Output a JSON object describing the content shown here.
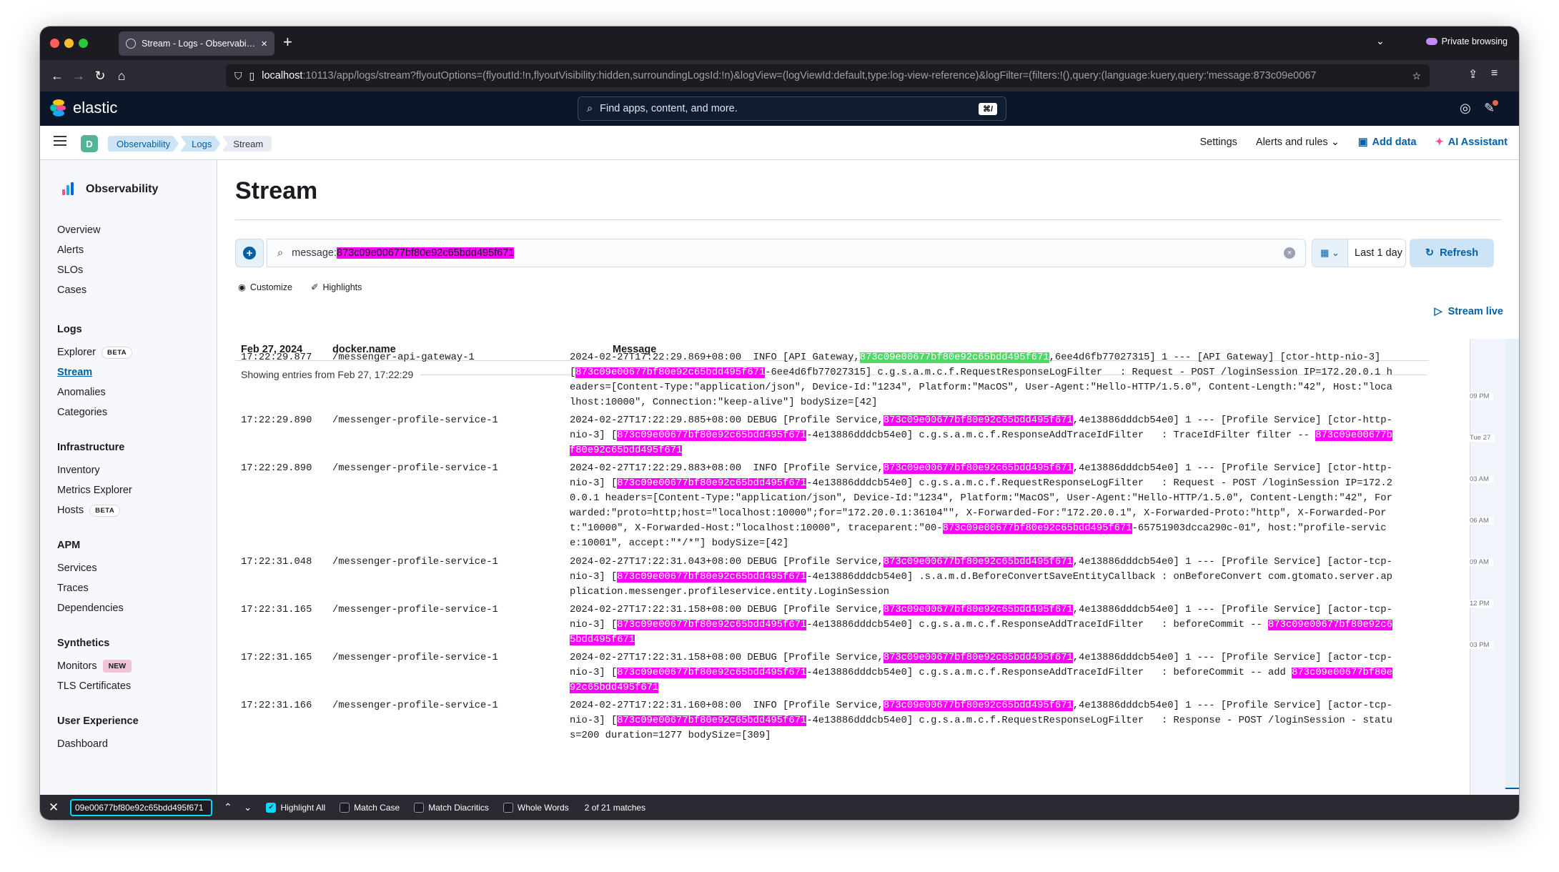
{
  "browser": {
    "tab_title": "Stream - Logs - Observability - Elastic",
    "new_tab": "+",
    "private_label": "Private browsing",
    "url_host": "localhost",
    "url_rest": ":10113/app/logs/stream?flyoutOptions=(flyoutId:!n,flyoutVisibility:hidden,surroundingLogsId:!n)&logView=(logViewId:default,type:log-view-reference)&logFilter=(filters:!(),query:(language:kuery,query:'message:873c09e0067"
  },
  "kibana": {
    "brand": "elastic",
    "search_placeholder": "Find apps, content, and more.",
    "search_shortcut": "⌘/",
    "space_letter": "D",
    "breadcrumbs": [
      "Observability",
      "Logs",
      "Stream"
    ],
    "header_links": {
      "settings": "Settings",
      "alerts": "Alerts and rules",
      "add_data": "Add data",
      "ai_assistant": "AI Assistant"
    }
  },
  "sidebar": {
    "title": "Observability",
    "top": [
      "Overview",
      "Alerts",
      "SLOs",
      "Cases"
    ],
    "logs": {
      "heading": "Logs",
      "explorer": "Explorer",
      "explorer_badge": "BETA",
      "stream": "Stream",
      "anomalies": "Anomalies",
      "categories": "Categories"
    },
    "infra": {
      "heading": "Infrastructure",
      "inventory": "Inventory",
      "metrics": "Metrics Explorer",
      "hosts": "Hosts",
      "hosts_badge": "BETA"
    },
    "apm": {
      "heading": "APM",
      "services": "Services",
      "traces": "Traces",
      "deps": "Dependencies"
    },
    "synth": {
      "heading": "Synthetics",
      "monitors": "Monitors",
      "monitors_badge": "NEW",
      "tls": "TLS Certificates"
    },
    "ux": {
      "heading": "User Experience",
      "dashboard": "Dashboard"
    }
  },
  "main": {
    "title": "Stream",
    "query_prefix": "message:",
    "query_value": "873c09e00677bf80e92c65bdd495f671",
    "date_range": "Last 1 day",
    "refresh": "Refresh",
    "customize": "Customize",
    "highlights": "Highlights",
    "stream_live": "Stream live",
    "columns": {
      "date": "Feb 27, 2024",
      "container": "docker.name",
      "message": "Message"
    },
    "showing": "Showing entries from Feb 27, 17:22:29"
  },
  "log_rows": [
    {
      "ts": "17:22:29.877",
      "container": "/messenger-api-gateway-1",
      "parts": [
        {
          "t": "2024-02-27T17:22:29.869+08:00  INFO [API Gateway,"
        },
        {
          "t": "873c09e00677bf80e92c65bdd495f671",
          "h": "g"
        },
        {
          "t": ",6ee4d6fb77027315] 1 --- [API Gateway] [ctor-http-nio-3] ["
        },
        {
          "t": "873c09e00677bf80e92c65bdd495f671",
          "h": "m"
        },
        {
          "t": "-6ee4d6fb77027315] c.g.s.a.m.c.f.RequestResponseLogFilter   : Request - POST /loginSession IP=172.20.0.1 headers=[Content-Type:\"application/json\", Device-Id:\"1234\", Platform:\"MacOS\", User-Agent:\"Hello-HTTP/1.5.0\", Content-Length:\"42\", Host:\"localhost:10000\", Connection:\"keep-alive\"] bodySize=[42]"
        }
      ]
    },
    {
      "ts": "17:22:29.890",
      "container": "/messenger-profile-service-1",
      "parts": [
        {
          "t": "2024-02-27T17:22:29.885+08:00 DEBUG [Profile Service,"
        },
        {
          "t": "873c09e00677bf80e92c65bdd495f671",
          "h": "m"
        },
        {
          "t": ",4e13886dddcb54e0] 1 --- [Profile Service] [ctor-http-nio-3] ["
        },
        {
          "t": "873c09e00677bf80e92c65bdd495f671",
          "h": "m"
        },
        {
          "t": "-4e13886dddcb54e0] c.g.s.a.m.c.f.ResponseAddTraceIdFilter   : TraceIdFilter filter -- "
        },
        {
          "t": "873c09e00677bf80e92c65bdd495f671",
          "h": "m"
        }
      ]
    },
    {
      "ts": "17:22:29.890",
      "container": "/messenger-profile-service-1",
      "parts": [
        {
          "t": "2024-02-27T17:22:29.883+08:00  INFO [Profile Service,"
        },
        {
          "t": "873c09e00677bf80e92c65bdd495f671",
          "h": "m"
        },
        {
          "t": ",4e13886dddcb54e0] 1 --- [Profile Service] [ctor-http-nio-3] ["
        },
        {
          "t": "873c09e00677bf80e92c65bdd495f671",
          "h": "m"
        },
        {
          "t": "-4e13886dddcb54e0] c.g.s.a.m.c.f.RequestResponseLogFilter   : Request - POST /loginSession IP=172.20.0.1 headers=[Content-Type:\"application/json\", Device-Id:\"1234\", Platform:\"MacOS\", User-Agent:\"Hello-HTTP/1.5.0\", Content-Length:\"42\", Forwarded:\"proto=http;host=\"localhost:10000\";for=\"172.20.0.1:36104\"\", X-Forwarded-For:\"172.20.0.1\", X-Forwarded-Proto:\"http\", X-Forwarded-Port:\"10000\", X-Forwarded-Host:\"localhost:10000\", traceparent:\"00-"
        },
        {
          "t": "873c09e00677bf80e92c65bdd495f671",
          "h": "m"
        },
        {
          "t": "-65751903dcca290c-01\", host:\"profile-service:10001\", accept:\"*/*\"] bodySize=[42]"
        }
      ]
    },
    {
      "ts": "17:22:31.048",
      "container": "/messenger-profile-service-1",
      "parts": [
        {
          "t": "2024-02-27T17:22:31.043+08:00 DEBUG [Profile Service,"
        },
        {
          "t": "873c09e00677bf80e92c65bdd495f671",
          "h": "m"
        },
        {
          "t": ",4e13886dddcb54e0] 1 --- [Profile Service] [actor-tcp-nio-3] ["
        },
        {
          "t": "873c09e00677bf80e92c65bdd495f671",
          "h": "m"
        },
        {
          "t": "-4e13886dddcb54e0] .s.a.m.d.BeforeConvertSaveEntityCallback : onBeforeConvert com.gtomato.server.application.messenger.profileservice.entity.LoginSession"
        }
      ]
    },
    {
      "ts": "17:22:31.165",
      "container": "/messenger-profile-service-1",
      "parts": [
        {
          "t": "2024-02-27T17:22:31.158+08:00 DEBUG [Profile Service,"
        },
        {
          "t": "873c09e00677bf80e92c65bdd495f671",
          "h": "m"
        },
        {
          "t": ",4e13886dddcb54e0] 1 --- [Profile Service] [actor-tcp-nio-3] ["
        },
        {
          "t": "873c09e00677bf80e92c65bdd495f671",
          "h": "m"
        },
        {
          "t": "-4e13886dddcb54e0] c.g.s.a.m.c.f.ResponseAddTraceIdFilter   : beforeCommit -- "
        },
        {
          "t": "873c09e00677bf80e92c65bdd495f671",
          "h": "m"
        }
      ]
    },
    {
      "ts": "17:22:31.165",
      "container": "/messenger-profile-service-1",
      "parts": [
        {
          "t": "2024-02-27T17:22:31.158+08:00 DEBUG [Profile Service,"
        },
        {
          "t": "873c09e00677bf80e92c65bdd495f671",
          "h": "m"
        },
        {
          "t": ",4e13886dddcb54e0] 1 --- [Profile Service] [actor-tcp-nio-3] ["
        },
        {
          "t": "873c09e00677bf80e92c65bdd495f671",
          "h": "m"
        },
        {
          "t": "-4e13886dddcb54e0] c.g.s.a.m.c.f.ResponseAddTraceIdFilter   : beforeCommit -- add "
        },
        {
          "t": "873c09e00677bf80e92c65bdd495f671",
          "h": "m"
        }
      ]
    },
    {
      "ts": "17:22:31.166",
      "container": "/messenger-profile-service-1",
      "parts": [
        {
          "t": "2024-02-27T17:22:31.160+08:00  INFO [Profile Service,"
        },
        {
          "t": "873c09e00677bf80e92c65bdd495f671",
          "h": "m"
        },
        {
          "t": ",4e13886dddcb54e0] 1 --- [Profile Service] [actor-tcp-nio-3] ["
        },
        {
          "t": "873c09e00677bf80e92c65bdd495f671",
          "h": "m"
        },
        {
          "t": "-4e13886dddcb54e0] c.g.s.a.m.c.f.RequestResponseLogFilter   : Response - POST /loginSession - status=200 duration=1277 bodySize=[309]"
        }
      ]
    }
  ],
  "minimap": {
    "labels": [
      "09 PM",
      "Tue 27",
      "03 AM",
      "06 AM",
      "09 AM",
      "12 PM",
      "03 PM"
    ]
  },
  "findbar": {
    "value": "09e00677bf80e92c65bdd495f671",
    "highlight_all": "Highlight All",
    "match_case": "Match Case",
    "match_diacritics": "Match Diacritics",
    "whole_words": "Whole Words",
    "matches": "2 of 21 matches"
  },
  "colors": {
    "highlight": "#ff00ff",
    "current_match": "#4cd964",
    "accent": "#0061a6"
  }
}
